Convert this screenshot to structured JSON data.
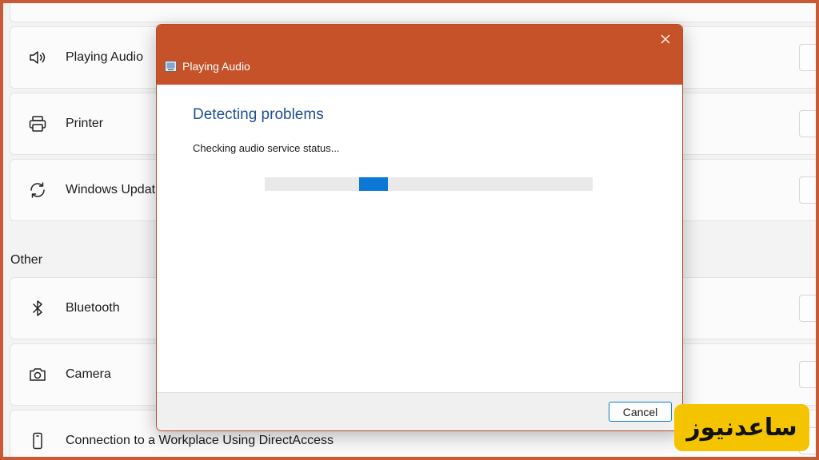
{
  "background": {
    "top_items": [
      {
        "label": "Playing Audio",
        "icon": "speaker-icon"
      },
      {
        "label": "Printer",
        "icon": "printer-icon"
      },
      {
        "label": "Windows Updat",
        "icon": "refresh-icon"
      }
    ],
    "section_title": "Other",
    "other_items": [
      {
        "label": "Bluetooth",
        "icon": "bluetooth-icon"
      },
      {
        "label": "Camera",
        "icon": "camera-icon"
      },
      {
        "label": "Connection to a Workplace Using DirectAccess",
        "icon": "phone-icon"
      }
    ]
  },
  "dialog": {
    "title": "Playing Audio",
    "heading": "Detecting problems",
    "status": "Checking audio service status...",
    "progress": {
      "indeterminate": true,
      "chunk_start_fraction": 0.288,
      "chunk_width_fraction": 0.088
    },
    "cancel_label": "Cancel",
    "close_icon": "close-icon"
  },
  "watermark": {
    "text": "ساعدنیوز"
  },
  "colors": {
    "accent": "#c6522a",
    "heading": "#1d4f91",
    "progress": "#0a78d4",
    "watermark_bg": "#f5c400"
  }
}
